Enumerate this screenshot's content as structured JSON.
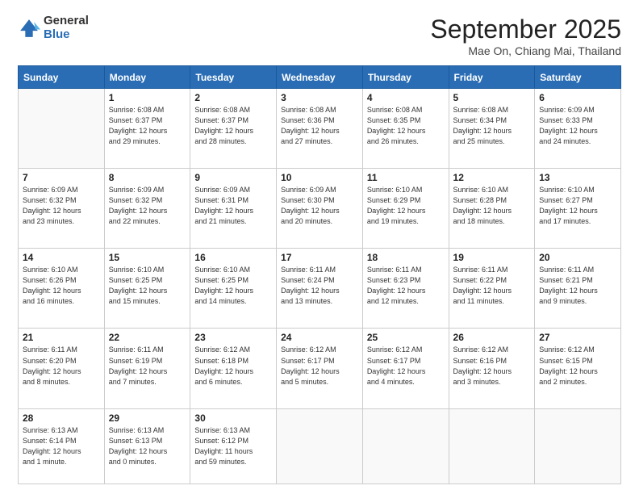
{
  "header": {
    "logo_general": "General",
    "logo_blue": "Blue",
    "month": "September 2025",
    "location": "Mae On, Chiang Mai, Thailand"
  },
  "weekdays": [
    "Sunday",
    "Monday",
    "Tuesday",
    "Wednesday",
    "Thursday",
    "Friday",
    "Saturday"
  ],
  "weeks": [
    [
      {
        "day": "",
        "info": ""
      },
      {
        "day": "1",
        "info": "Sunrise: 6:08 AM\nSunset: 6:37 PM\nDaylight: 12 hours\nand 29 minutes."
      },
      {
        "day": "2",
        "info": "Sunrise: 6:08 AM\nSunset: 6:37 PM\nDaylight: 12 hours\nand 28 minutes."
      },
      {
        "day": "3",
        "info": "Sunrise: 6:08 AM\nSunset: 6:36 PM\nDaylight: 12 hours\nand 27 minutes."
      },
      {
        "day": "4",
        "info": "Sunrise: 6:08 AM\nSunset: 6:35 PM\nDaylight: 12 hours\nand 26 minutes."
      },
      {
        "day": "5",
        "info": "Sunrise: 6:08 AM\nSunset: 6:34 PM\nDaylight: 12 hours\nand 25 minutes."
      },
      {
        "day": "6",
        "info": "Sunrise: 6:09 AM\nSunset: 6:33 PM\nDaylight: 12 hours\nand 24 minutes."
      }
    ],
    [
      {
        "day": "7",
        "info": "Sunrise: 6:09 AM\nSunset: 6:32 PM\nDaylight: 12 hours\nand 23 minutes."
      },
      {
        "day": "8",
        "info": "Sunrise: 6:09 AM\nSunset: 6:32 PM\nDaylight: 12 hours\nand 22 minutes."
      },
      {
        "day": "9",
        "info": "Sunrise: 6:09 AM\nSunset: 6:31 PM\nDaylight: 12 hours\nand 21 minutes."
      },
      {
        "day": "10",
        "info": "Sunrise: 6:09 AM\nSunset: 6:30 PM\nDaylight: 12 hours\nand 20 minutes."
      },
      {
        "day": "11",
        "info": "Sunrise: 6:10 AM\nSunset: 6:29 PM\nDaylight: 12 hours\nand 19 minutes."
      },
      {
        "day": "12",
        "info": "Sunrise: 6:10 AM\nSunset: 6:28 PM\nDaylight: 12 hours\nand 18 minutes."
      },
      {
        "day": "13",
        "info": "Sunrise: 6:10 AM\nSunset: 6:27 PM\nDaylight: 12 hours\nand 17 minutes."
      }
    ],
    [
      {
        "day": "14",
        "info": "Sunrise: 6:10 AM\nSunset: 6:26 PM\nDaylight: 12 hours\nand 16 minutes."
      },
      {
        "day": "15",
        "info": "Sunrise: 6:10 AM\nSunset: 6:25 PM\nDaylight: 12 hours\nand 15 minutes."
      },
      {
        "day": "16",
        "info": "Sunrise: 6:10 AM\nSunset: 6:25 PM\nDaylight: 12 hours\nand 14 minutes."
      },
      {
        "day": "17",
        "info": "Sunrise: 6:11 AM\nSunset: 6:24 PM\nDaylight: 12 hours\nand 13 minutes."
      },
      {
        "day": "18",
        "info": "Sunrise: 6:11 AM\nSunset: 6:23 PM\nDaylight: 12 hours\nand 12 minutes."
      },
      {
        "day": "19",
        "info": "Sunrise: 6:11 AM\nSunset: 6:22 PM\nDaylight: 12 hours\nand 11 minutes."
      },
      {
        "day": "20",
        "info": "Sunrise: 6:11 AM\nSunset: 6:21 PM\nDaylight: 12 hours\nand 9 minutes."
      }
    ],
    [
      {
        "day": "21",
        "info": "Sunrise: 6:11 AM\nSunset: 6:20 PM\nDaylight: 12 hours\nand 8 minutes."
      },
      {
        "day": "22",
        "info": "Sunrise: 6:11 AM\nSunset: 6:19 PM\nDaylight: 12 hours\nand 7 minutes."
      },
      {
        "day": "23",
        "info": "Sunrise: 6:12 AM\nSunset: 6:18 PM\nDaylight: 12 hours\nand 6 minutes."
      },
      {
        "day": "24",
        "info": "Sunrise: 6:12 AM\nSunset: 6:17 PM\nDaylight: 12 hours\nand 5 minutes."
      },
      {
        "day": "25",
        "info": "Sunrise: 6:12 AM\nSunset: 6:17 PM\nDaylight: 12 hours\nand 4 minutes."
      },
      {
        "day": "26",
        "info": "Sunrise: 6:12 AM\nSunset: 6:16 PM\nDaylight: 12 hours\nand 3 minutes."
      },
      {
        "day": "27",
        "info": "Sunrise: 6:12 AM\nSunset: 6:15 PM\nDaylight: 12 hours\nand 2 minutes."
      }
    ],
    [
      {
        "day": "28",
        "info": "Sunrise: 6:13 AM\nSunset: 6:14 PM\nDaylight: 12 hours\nand 1 minute."
      },
      {
        "day": "29",
        "info": "Sunrise: 6:13 AM\nSunset: 6:13 PM\nDaylight: 12 hours\nand 0 minutes."
      },
      {
        "day": "30",
        "info": "Sunrise: 6:13 AM\nSunset: 6:12 PM\nDaylight: 11 hours\nand 59 minutes."
      },
      {
        "day": "",
        "info": ""
      },
      {
        "day": "",
        "info": ""
      },
      {
        "day": "",
        "info": ""
      },
      {
        "day": "",
        "info": ""
      }
    ]
  ]
}
